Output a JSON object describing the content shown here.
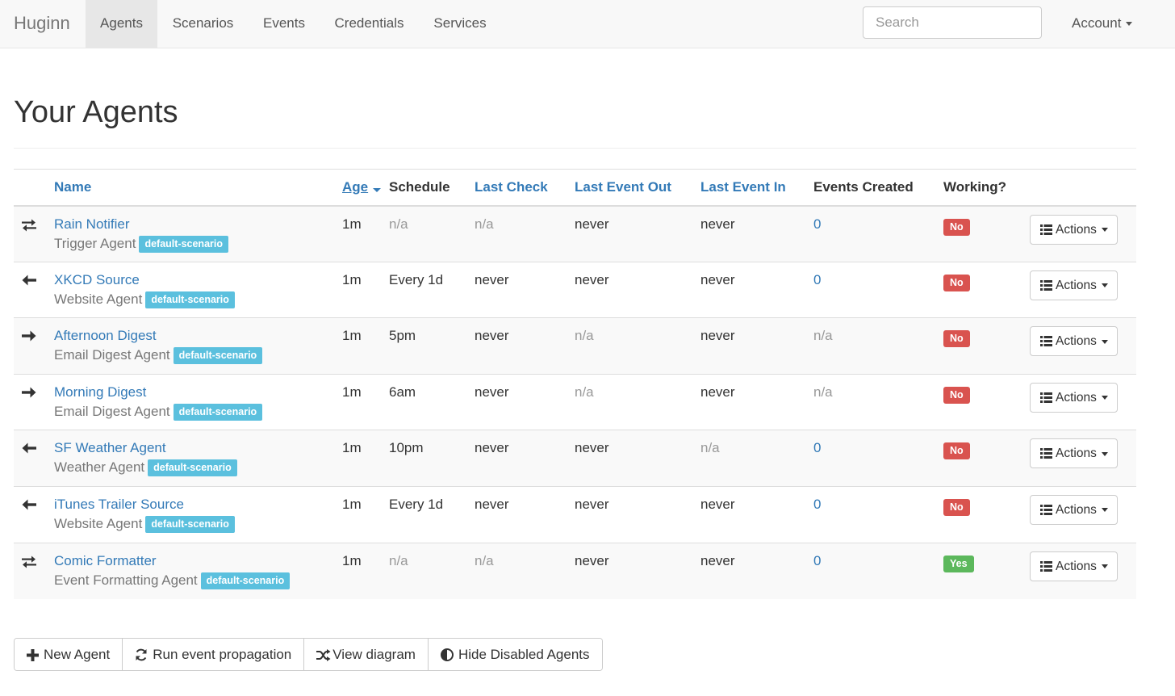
{
  "navbar": {
    "brand": "Huginn",
    "items": [
      {
        "label": "Agents",
        "active": true
      },
      {
        "label": "Scenarios",
        "active": false
      },
      {
        "label": "Events",
        "active": false
      },
      {
        "label": "Credentials",
        "active": false
      },
      {
        "label": "Services",
        "active": false
      }
    ],
    "search_placeholder": "Search",
    "account_label": "Account"
  },
  "page": {
    "title": "Your Agents"
  },
  "table": {
    "headers": {
      "name": "Name",
      "age": "Age",
      "schedule": "Schedule",
      "last_check": "Last Check",
      "last_event_out": "Last Event Out",
      "last_event_in": "Last Event In",
      "events_created": "Events Created",
      "working": "Working?"
    },
    "rows": [
      {
        "direction_icon": "exchange-icon",
        "name": "Rain Notifier",
        "type": "Trigger Agent",
        "scenario": "default-scenario",
        "age": "1m",
        "schedule": "n/a",
        "last_check": "n/a",
        "last_event_out": "never",
        "last_event_in": "never",
        "events_created": "0",
        "working": "No",
        "actions": "Actions"
      },
      {
        "direction_icon": "arrow-left-icon",
        "name": "XKCD Source",
        "type": "Website Agent",
        "scenario": "default-scenario",
        "age": "1m",
        "schedule": "Every 1d",
        "last_check": "never",
        "last_event_out": "never",
        "last_event_in": "never",
        "events_created": "0",
        "working": "No",
        "actions": "Actions"
      },
      {
        "direction_icon": "arrow-right-icon",
        "name": "Afternoon Digest",
        "type": "Email Digest Agent",
        "scenario": "default-scenario",
        "age": "1m",
        "schedule": "5pm",
        "last_check": "never",
        "last_event_out": "n/a",
        "last_event_in": "never",
        "events_created": "n/a",
        "working": "No",
        "actions": "Actions"
      },
      {
        "direction_icon": "arrow-right-icon",
        "name": "Morning Digest",
        "type": "Email Digest Agent",
        "scenario": "default-scenario",
        "age": "1m",
        "schedule": "6am",
        "last_check": "never",
        "last_event_out": "n/a",
        "last_event_in": "never",
        "events_created": "n/a",
        "working": "No",
        "actions": "Actions"
      },
      {
        "direction_icon": "arrow-left-icon",
        "name": "SF Weather Agent",
        "type": "Weather Agent",
        "scenario": "default-scenario",
        "age": "1m",
        "schedule": "10pm",
        "last_check": "never",
        "last_event_out": "never",
        "last_event_in": "n/a",
        "events_created": "0",
        "working": "No",
        "actions": "Actions"
      },
      {
        "direction_icon": "arrow-left-icon",
        "name": "iTunes Trailer Source",
        "type": "Website Agent",
        "scenario": "default-scenario",
        "age": "1m",
        "schedule": "Every 1d",
        "last_check": "never",
        "last_event_out": "never",
        "last_event_in": "never",
        "events_created": "0",
        "working": "No",
        "actions": "Actions"
      },
      {
        "direction_icon": "exchange-icon",
        "name": "Comic Formatter",
        "type": "Event Formatting Agent",
        "scenario": "default-scenario",
        "age": "1m",
        "schedule": "n/a",
        "last_check": "n/a",
        "last_event_out": "never",
        "last_event_in": "never",
        "events_created": "0",
        "working": "Yes",
        "actions": "Actions"
      }
    ]
  },
  "footer_buttons": {
    "new_agent": "New Agent",
    "run_propagation": "Run event propagation",
    "view_diagram": "View diagram",
    "hide_disabled": "Hide Disabled Agents"
  },
  "colors": {
    "link": "#337ab7",
    "scenario_label": "#5bc0de",
    "status_no": "#d9534f",
    "status_yes": "#5cb85c",
    "navbar_bg": "#f8f8f8"
  }
}
